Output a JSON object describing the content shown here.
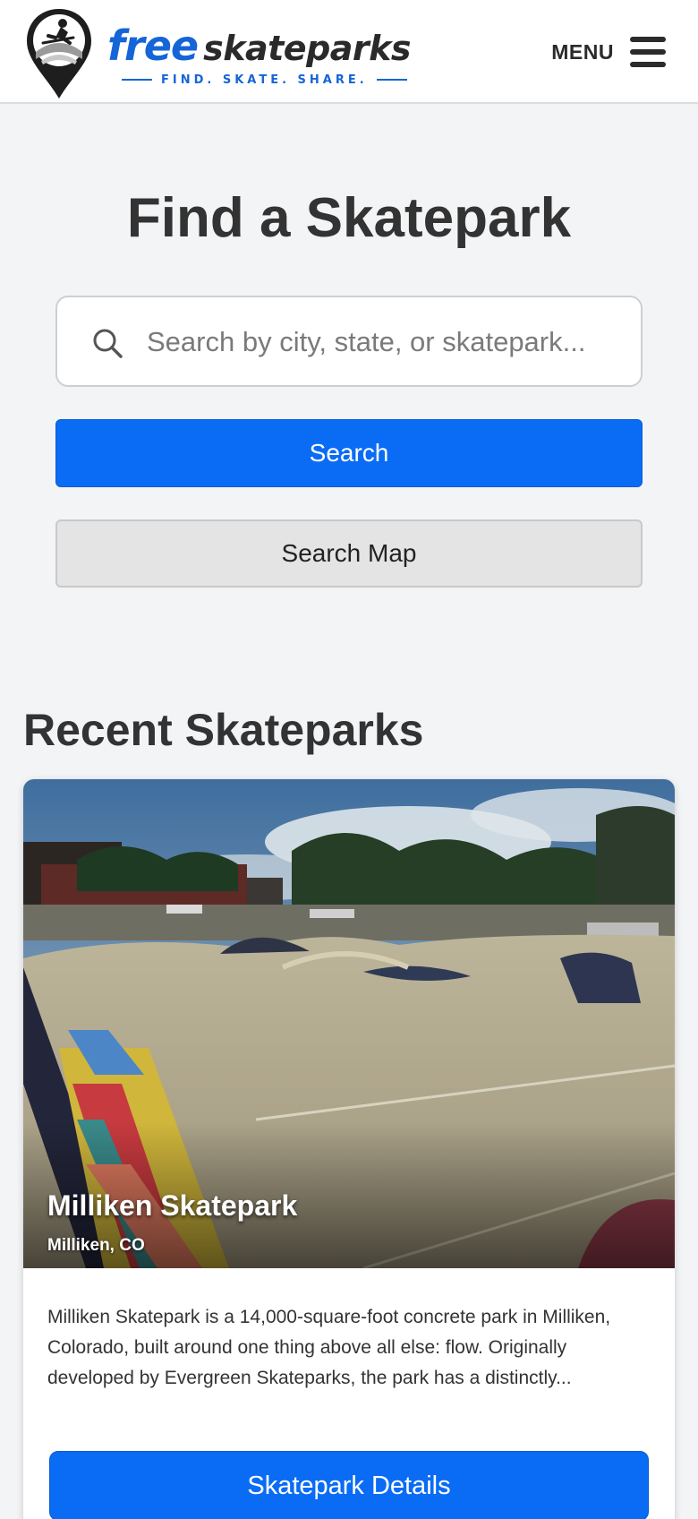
{
  "header": {
    "logo_word_free": "free",
    "logo_word_skateparks": "skateparks",
    "tagline": "FIND. SKATE. SHARE.",
    "menu_label": "MENU",
    "brand_blue": "#1565d8",
    "logo_icon": "skater-map-pin-icon",
    "menu_icon": "hamburger-icon"
  },
  "find": {
    "title": "Find a Skatepark",
    "search_placeholder": "Search by city, state, or skatepark...",
    "search_icon": "search-icon",
    "search_button": "Search",
    "search_map_button": "Search Map"
  },
  "recent": {
    "title": "Recent Skateparks",
    "cards": [
      {
        "name": "Milliken Skatepark",
        "location": "Milliken, CO",
        "description": "Milliken Skatepark is a 14,000-square-foot concrete park in Milliken, Colorado, built around one thing above all else: flow. Originally developed by Evergreen Skateparks, the park has a distinctly...",
        "button": "Skatepark Details"
      }
    ]
  },
  "colors": {
    "primary_button": "#0a6cf5",
    "secondary_button": "#e4e4e4",
    "page_background": "#f3f4f6"
  }
}
